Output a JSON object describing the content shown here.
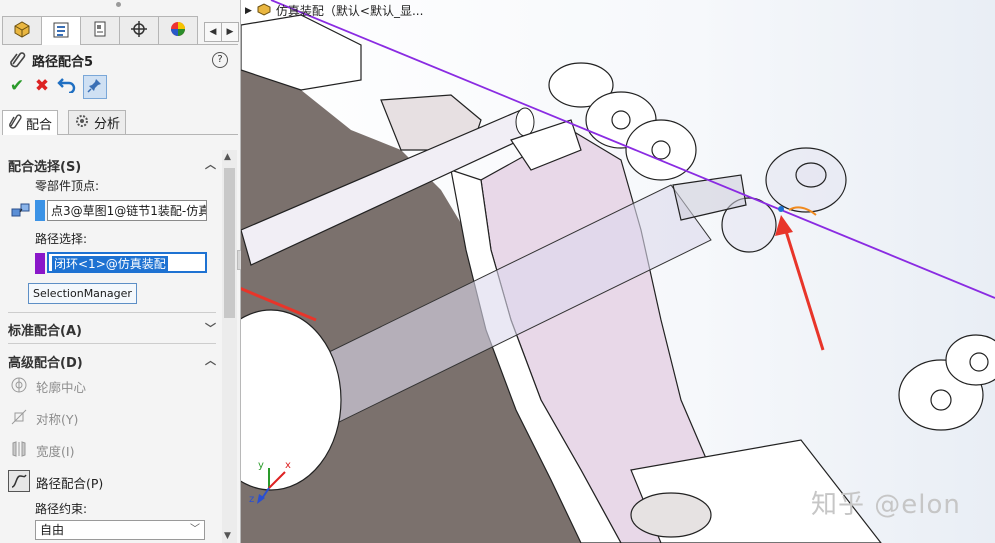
{
  "panel": {
    "title": "路径配合5",
    "help_label": "?",
    "tabs": [
      "feature-manager",
      "property-manager",
      "configuration-manager",
      "dim-xpert-manager",
      "display-manager"
    ],
    "subtabs": {
      "mates": "配合",
      "analysis": "分析"
    },
    "mate_selections": {
      "header": "配合选择(S)",
      "component_vertex_label": "零部件顶点:",
      "component_vertex_value": "点3@草图1@链节1装配-仿真",
      "path_selection_label": "路径选择:",
      "path_selection_value": "闭环<1>@仿真装配",
      "selection_manager_label": "SelectionManager",
      "colors": {
        "vertex": "#3c93e6",
        "path": "#8a17c9"
      }
    },
    "standard_mates": {
      "header": "标准配合(A)"
    },
    "advanced_mates": {
      "header": "高级配合(D)",
      "items": [
        {
          "label": "轮廓中心",
          "icon": "profile-center-icon"
        },
        {
          "label": "对称(Y)",
          "icon": "symmetric-icon"
        },
        {
          "label": "宽度(I)",
          "icon": "width-icon"
        },
        {
          "label": "路径配合(P)",
          "icon": "path-mate-icon"
        }
      ],
      "path_constraint_label": "路径约束:",
      "path_constraint_value": "自由"
    }
  },
  "viewport": {
    "title": "仿真装配（默认<默认_显...",
    "watermark": "知乎 @elon",
    "triad": {
      "x": "x",
      "y": "y",
      "z": "z"
    },
    "colors": {
      "path_line": "#8a2be2",
      "arrow": "#e8352a",
      "part_fill": "#ffffff",
      "part_shadow": "#7a6f6a",
      "pink": "#e9d9ea"
    }
  }
}
